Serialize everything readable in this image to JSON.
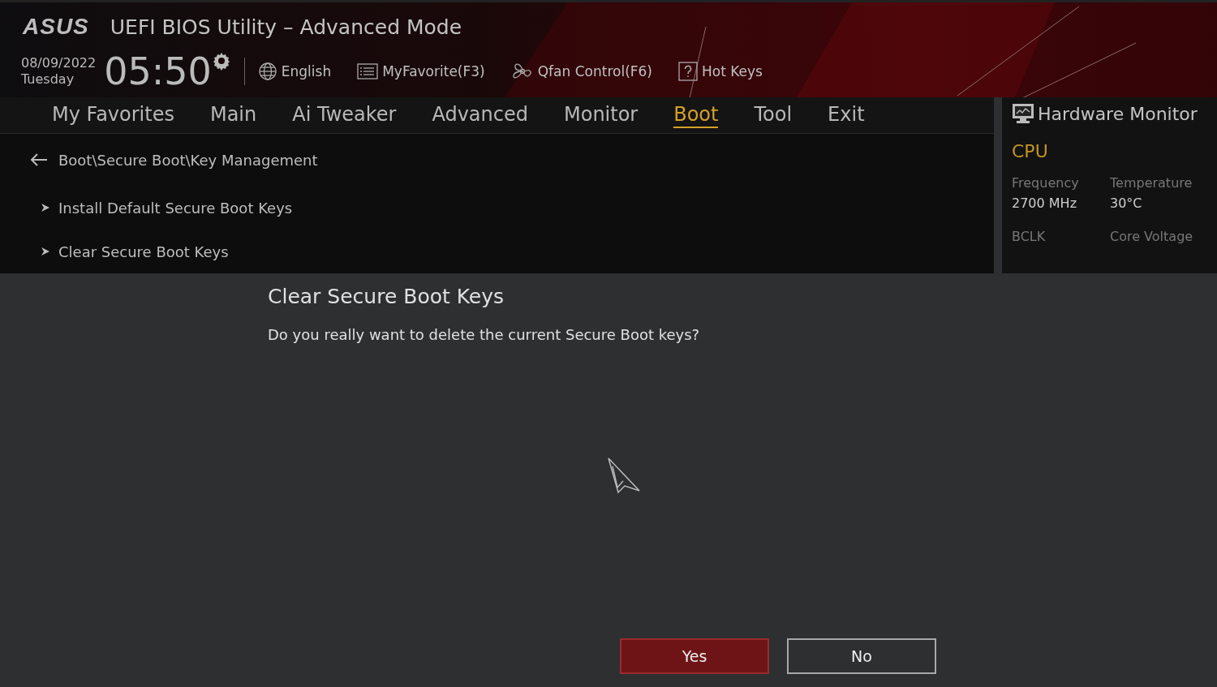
{
  "header": {
    "logo": "ASUS",
    "title": "UEFI BIOS Utility – Advanced Mode",
    "date": "08/09/2022",
    "weekday": "Tuesday",
    "time": "05:50",
    "tools": [
      {
        "kind": "globe",
        "label": "English"
      },
      {
        "kind": "list",
        "label": "MyFavorite(F3)"
      },
      {
        "kind": "fan",
        "label": "Qfan Control(F6)"
      },
      {
        "kind": "help",
        "label": "Hot Keys"
      }
    ]
  },
  "tabs": [
    {
      "label": "My Favorites",
      "selected": false
    },
    {
      "label": "Main",
      "selected": false
    },
    {
      "label": "Ai Tweaker",
      "selected": false
    },
    {
      "label": "Advanced",
      "selected": false
    },
    {
      "label": "Monitor",
      "selected": false
    },
    {
      "label": "Boot",
      "selected": true
    },
    {
      "label": "Tool",
      "selected": false
    },
    {
      "label": "Exit",
      "selected": false
    }
  ],
  "breadcrumb": "Boot\\Secure Boot\\Key Management",
  "items": [
    "Install Default Secure Boot Keys",
    "Clear Secure Boot Keys"
  ],
  "hardware_monitor": {
    "title": "Hardware Monitor",
    "section": "CPU",
    "readings": [
      {
        "label": "Frequency",
        "value": "2700 MHz"
      },
      {
        "label": "Temperature",
        "value": "30°C"
      },
      {
        "label": "BCLK"
      },
      {
        "label": "Core Voltage"
      }
    ]
  },
  "dialog": {
    "title": "Clear Secure Boot Keys",
    "message": "Do you really want to delete the current Secure Boot keys?",
    "buttons": [
      {
        "label": "Yes",
        "selected": true
      },
      {
        "label": "No",
        "selected": false
      }
    ]
  }
}
